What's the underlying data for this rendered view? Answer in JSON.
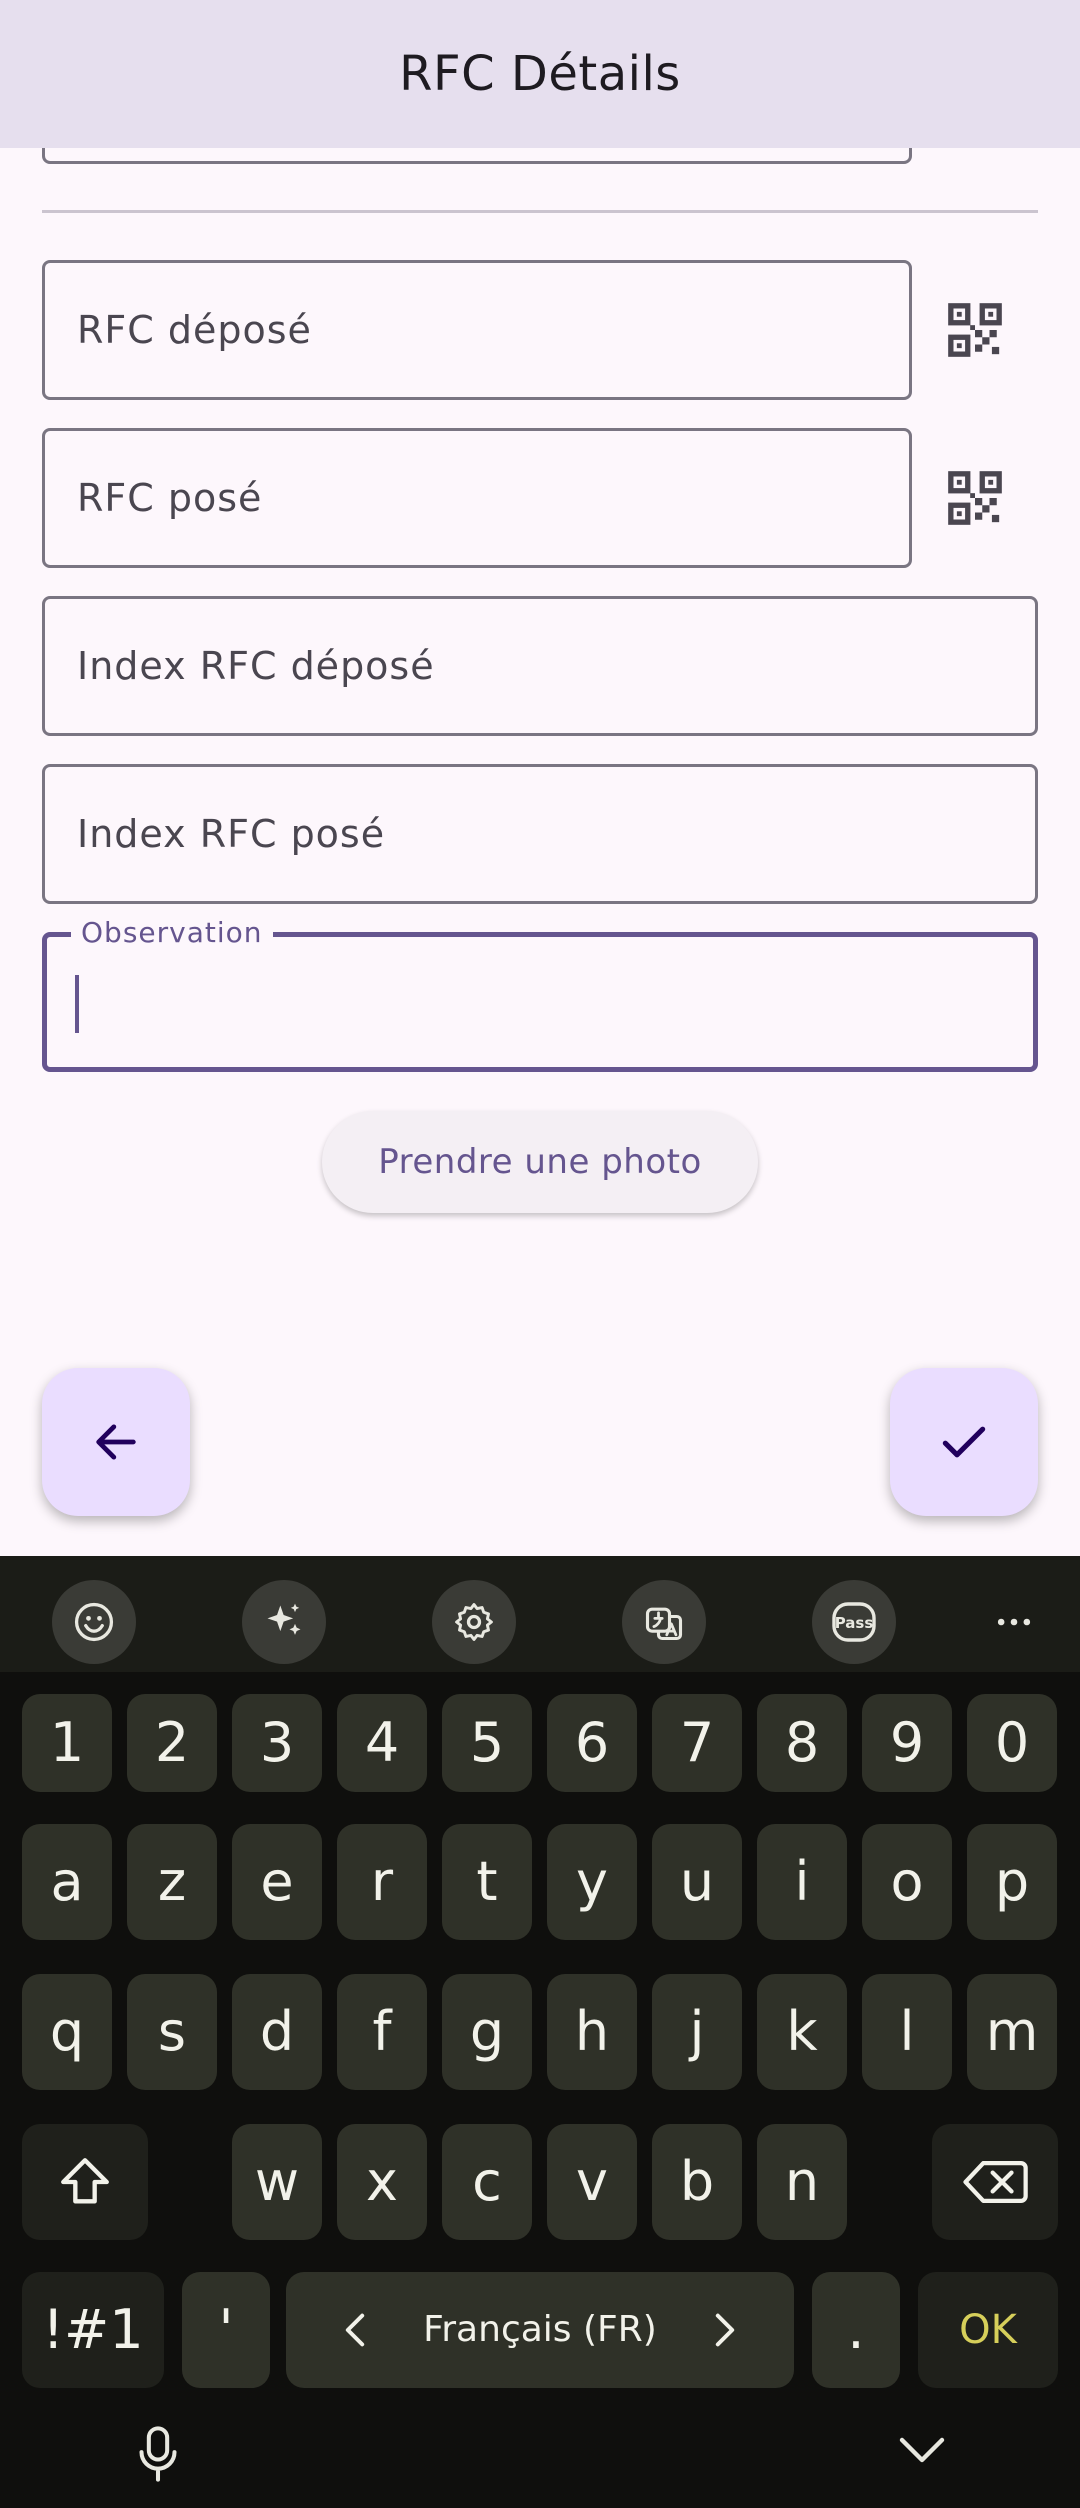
{
  "appbar": {
    "title": "RFC Détails"
  },
  "form": {
    "rfc_depose": "RFC déposé",
    "rfc_pose": "RFC posé",
    "index_rfc_depose": "Index RFC déposé",
    "index_rfc_pose": "Index RFC posé",
    "observation_label": "Observation",
    "observation_value": ""
  },
  "buttons": {
    "take_photo": "Prendre une photo",
    "back_icon": "arrow-left-icon",
    "confirm_icon": "check-icon"
  },
  "colors": {
    "appbar_bg": "#e6dfee",
    "page_bg": "#fdf7fc",
    "accent": "#65558f",
    "fab_bg": "#eaddff",
    "keyboard_bg": "#0f0f0d",
    "key_bg": "#2f3128",
    "ok_color": "#d6cf5a"
  },
  "keyboard": {
    "toolbar_icons": [
      "emoji-icon",
      "sparkle-ai-icon",
      "settings-icon",
      "translate-icon",
      "pass-icon",
      "more-icon"
    ],
    "toolbar_pass_label": "Pass",
    "row_numbers": [
      "1",
      "2",
      "3",
      "4",
      "5",
      "6",
      "7",
      "8",
      "9",
      "0"
    ],
    "row1": [
      "a",
      "z",
      "e",
      "r",
      "t",
      "y",
      "u",
      "i",
      "o",
      "p"
    ],
    "row2": [
      "q",
      "s",
      "d",
      "f",
      "g",
      "h",
      "j",
      "k",
      "l",
      "m"
    ],
    "row3": [
      "w",
      "x",
      "c",
      "v",
      "b",
      "n"
    ],
    "symbols_key": "!#1",
    "apostrophe_key": "'",
    "space_language": "Français (FR)",
    "period_key": ".",
    "ok_key": "OK"
  },
  "navbar": {
    "left_icon": "microphone-icon",
    "right_icon": "chevron-down-icon"
  }
}
